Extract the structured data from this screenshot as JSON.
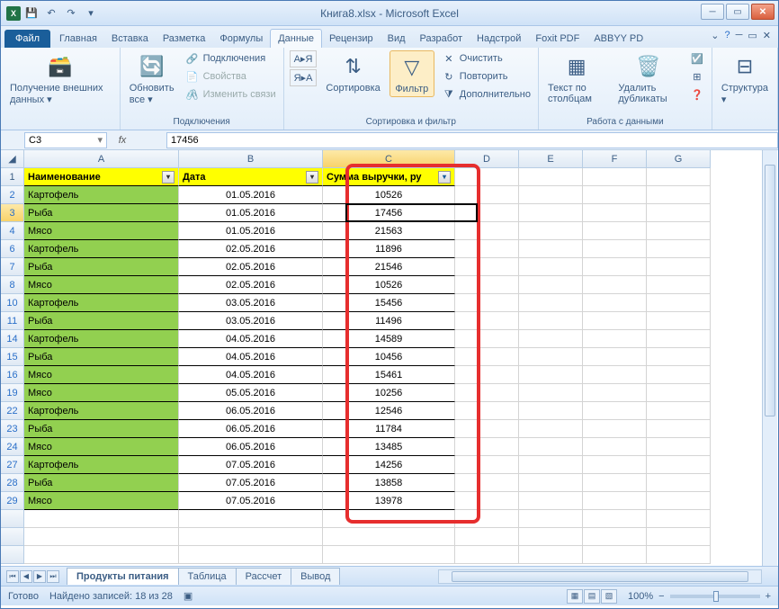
{
  "title": "Книга8.xlsx - Microsoft Excel",
  "tabs": {
    "file": "Файл",
    "home": "Главная",
    "insert": "Вставка",
    "layout": "Разметка",
    "formulas": "Формулы",
    "data": "Данные",
    "review": "Рецензир",
    "view": "Вид",
    "dev": "Разработ",
    "addins": "Надстрой",
    "foxit": "Foxit PDF",
    "abbyy": "ABBYY PD"
  },
  "ribbon": {
    "ext_data": "Получение внешних данных",
    "ext_data_dd": "▾",
    "refresh": "Обновить все",
    "refresh_dd": "▾",
    "conn": "Подключения",
    "props": "Свойства",
    "links": "Изменить связи",
    "conn_group": "Подключения",
    "sort_az": "А▸Я",
    "sort_za": "Я▸А",
    "sort": "Сортировка",
    "filter": "Фильтр",
    "clear": "Очистить",
    "reapply": "Повторить",
    "advanced": "Дополнительно",
    "sortfilter_group": "Сортировка и фильтр",
    "t2c": "Текст по столбцам",
    "dedup": "Удалить дубликаты",
    "datatools_group": "Работа с данными",
    "outline": "Структура",
    "outline_dd": "▾"
  },
  "namebox": "C3",
  "fx": "fx",
  "formula": "17456",
  "cols": [
    "A",
    "B",
    "C",
    "D",
    "E",
    "F",
    "G"
  ],
  "headers": {
    "a": "Наименование",
    "b": "Дата",
    "c": "Сумма выручки, ру"
  },
  "rows": [
    {
      "n": 2,
      "a": "Картофель",
      "b": "01.05.2016",
      "c": "10526"
    },
    {
      "n": 3,
      "a": "Рыба",
      "b": "01.05.2016",
      "c": "17456"
    },
    {
      "n": 4,
      "a": "Мясо",
      "b": "01.05.2016",
      "c": "21563"
    },
    {
      "n": 6,
      "a": "Картофель",
      "b": "02.05.2016",
      "c": "11896"
    },
    {
      "n": 7,
      "a": "Рыба",
      "b": "02.05.2016",
      "c": "21546"
    },
    {
      "n": 8,
      "a": "Мясо",
      "b": "02.05.2016",
      "c": "10526"
    },
    {
      "n": 10,
      "a": "Картофель",
      "b": "03.05.2016",
      "c": "15456"
    },
    {
      "n": 11,
      "a": "Рыба",
      "b": "03.05.2016",
      "c": "11496"
    },
    {
      "n": 14,
      "a": "Картофель",
      "b": "04.05.2016",
      "c": "14589"
    },
    {
      "n": 15,
      "a": "Рыба",
      "b": "04.05.2016",
      "c": "10456"
    },
    {
      "n": 16,
      "a": "Мясо",
      "b": "04.05.2016",
      "c": "15461"
    },
    {
      "n": 19,
      "a": "Мясо",
      "b": "05.05.2016",
      "c": "10256"
    },
    {
      "n": 22,
      "a": "Картофель",
      "b": "06.05.2016",
      "c": "12546"
    },
    {
      "n": 23,
      "a": "Рыба",
      "b": "06.05.2016",
      "c": "11784"
    },
    {
      "n": 24,
      "a": "Мясо",
      "b": "06.05.2016",
      "c": "13485"
    },
    {
      "n": 27,
      "a": "Картофель",
      "b": "07.05.2016",
      "c": "14256"
    },
    {
      "n": 28,
      "a": "Рыба",
      "b": "07.05.2016",
      "c": "13858"
    },
    {
      "n": 29,
      "a": "Мясо",
      "b": "07.05.2016",
      "c": "13978"
    }
  ],
  "sheets": {
    "s1": "Продукты питания",
    "s2": "Таблица",
    "s3": "Рассчет",
    "s4": "Вывод"
  },
  "status": {
    "ready": "Готово",
    "found": "Найдено записей: 18 из 28",
    "zoom": "100%",
    "minus": "−",
    "plus": "+"
  }
}
